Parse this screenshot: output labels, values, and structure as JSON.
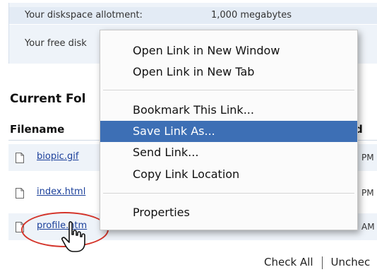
{
  "disk": {
    "allotment_label": "Your diskspace allotment:",
    "allotment_value": "1,000 megabytes",
    "free_label": "Your free disk"
  },
  "folder": {
    "title": "Current Fol",
    "col_filename": "Filename",
    "col_right": "d"
  },
  "files": [
    {
      "name": "biopic.gif",
      "time": "PM"
    },
    {
      "name": "index.html",
      "time": "PM"
    },
    {
      "name": "profile.htm",
      "time": "AM"
    }
  ],
  "context_menu": {
    "items": [
      "Open Link in New Window",
      "Open Link in New Tab",
      "Bookmark This Link...",
      "Save Link As...",
      "Send Link...",
      "Copy Link Location",
      "Properties"
    ],
    "selected_index": 3
  },
  "bottom": {
    "check_all": "Check All",
    "uncheck": "Unchec"
  },
  "colors": {
    "selection": "#3d6fb5",
    "link": "#1a3f9a",
    "highlight_ring": "#d4342a",
    "panel_bg": "#eef3f9"
  }
}
